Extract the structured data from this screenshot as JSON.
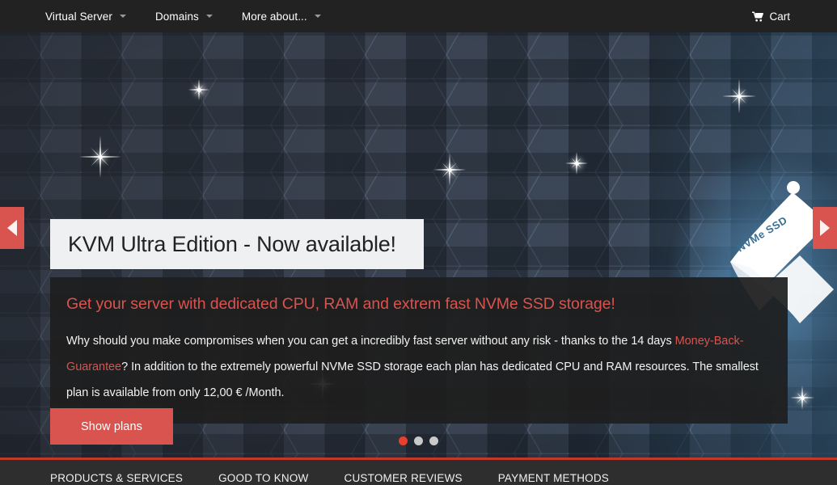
{
  "navbar": {
    "items": [
      {
        "label": "Virtual Server",
        "has_caret": true
      },
      {
        "label": "Domains",
        "has_caret": true
      },
      {
        "label": "More about...",
        "has_caret": true
      }
    ],
    "cart": {
      "label": "Cart",
      "icon": "shopping-cart-icon",
      "glyph": "Ὥ2"
    }
  },
  "hero": {
    "slide": {
      "title": "KVM Ultra Edition - Now available!",
      "subtitle": "Get your server with dedicated CPU, RAM and extrem fast NVMe SSD storage!",
      "body_part_1": "Why should you make compromises when you can get a incredibly fast server without any risk - thanks to the 14 days ",
      "body_link": "Money-Back-Guarantee",
      "body_part_2": "? In addition to the extremely powerful NVMe SSD storage each plan has dedicated CPU and RAM resources. The smallest plan is available from only 12,00 € /Month.",
      "cta_label": "Show plans"
    },
    "flag_label": "NVMe SSD",
    "prev_arrow": "◀",
    "next_arrow": "▶",
    "dots": [
      {
        "active": true
      },
      {
        "active": false
      },
      {
        "active": false
      }
    ]
  },
  "footer": {
    "columns": [
      "PRODUCTS & SERVICES",
      "GOOD TO KNOW",
      "CUSTOMER REVIEWS",
      "PAYMENT METHODS"
    ]
  },
  "colors": {
    "accent_red": "#d9534f",
    "rule_red": "#c0392b",
    "navbar_bg": "#222222",
    "panel_bg": "#1e1e1e",
    "title_bg": "#eef0f1",
    "hex_blue": "#548eba",
    "dot_active": "#e8402a"
  }
}
